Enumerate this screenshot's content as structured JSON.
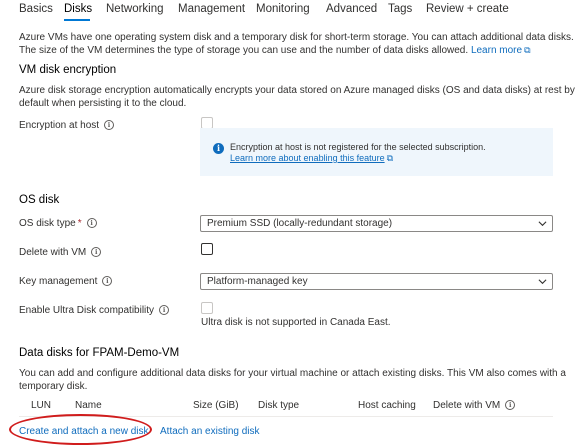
{
  "tabs": [
    "Basics",
    "Disks",
    "Networking",
    "Management",
    "Monitoring",
    "Advanced",
    "Tags",
    "Review + create"
  ],
  "active_tab": "Disks",
  "intro": {
    "line1": "Azure VMs have one operating system disk and a temporary disk for short-term storage. You can attach additional data disks.",
    "line2": "The size of the VM determines the type of storage you can use and the number of data disks allowed.",
    "learn_more": "Learn more"
  },
  "encryption": {
    "heading": "VM disk encryption",
    "desc_line1": "Azure disk storage encryption automatically encrypts your data stored on Azure managed disks (OS and data disks) at rest by",
    "desc_line2": "default when persisting it to the cloud.",
    "host_label": "Encryption at host",
    "info_message": "Encryption at host is not registered for the selected subscription.",
    "info_link": "Learn more about enabling this feature"
  },
  "os_disk": {
    "heading": "OS disk",
    "type_label": "OS disk type",
    "required_mark": "*",
    "type_value": "Premium SSD (locally-redundant storage)",
    "delete_label": "Delete with VM",
    "key_label": "Key management",
    "key_value": "Platform-managed key",
    "ultra_label": "Enable Ultra Disk compatibility",
    "ultra_note": "Ultra disk is not supported in Canada East."
  },
  "data_disks": {
    "heading": "Data disks for FPAM-Demo-VM",
    "desc_line1": "You can add and configure additional data disks for your virtual machine or attach existing disks. This VM also comes with a",
    "desc_line2": "temporary disk.",
    "columns": [
      "LUN",
      "Name",
      "Size (GiB)",
      "Disk type",
      "Host caching",
      "Delete with VM"
    ],
    "create_link": "Create and attach a new disk",
    "attach_link": "Attach an existing disk"
  },
  "colors": {
    "accent": "#0078d4",
    "link": "#0f6cbd",
    "annotation": "#d01c1c",
    "info_bg": "#eff6fc"
  },
  "icons": [
    "info-icon",
    "external-link-icon",
    "chevron-down-icon"
  ]
}
